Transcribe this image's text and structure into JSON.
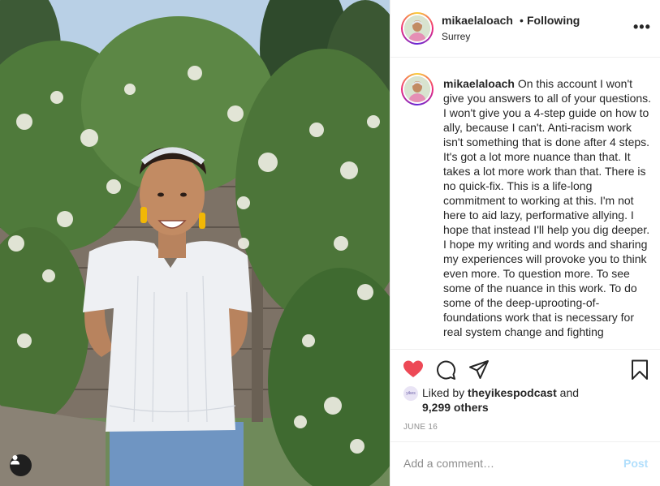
{
  "post": {
    "username": "mikaelaloach",
    "follow_separator": "•",
    "follow_status": "Following",
    "location": "Surrey",
    "more_label": "•••",
    "caption_username": "mikaelaloach",
    "caption_text": "On this account I won't give you answers to all of your questions. I won't give you a 4-step guide on how to ally, because I can't. Anti-racism work isn't something that is done after 4 steps. It's got a lot more nuance than that. It takes a lot more work than that. There is no quick-fix. This is a life-long commitment to working at this. I'm not here to aid lazy, performative allying. I hope that instead I'll help you dig deeper. I hope my writing and words and sharing my experiences will provoke you to think even more. To question more. To see some of the nuance in this work. To do some of the deep-uprooting-of-foundations work that is necessary for real system change and fighting",
    "liked_prefix": "Liked by",
    "liked_user": "theyikespodcast",
    "liked_and": "and",
    "liked_others": "9,299 others",
    "liked_avatar_text": "yikes",
    "date": "JUNE 16",
    "comment_placeholder": "Add a comment…",
    "post_label": "Post"
  },
  "colors": {
    "heart": "#ed4956",
    "post_disabled": "#b2dffc",
    "muted_text": "#8e8e8e"
  },
  "icons": {
    "like": "heart-icon",
    "comment": "comment-icon",
    "share": "share-icon",
    "save": "bookmark-icon",
    "tag": "user-tag-icon"
  }
}
